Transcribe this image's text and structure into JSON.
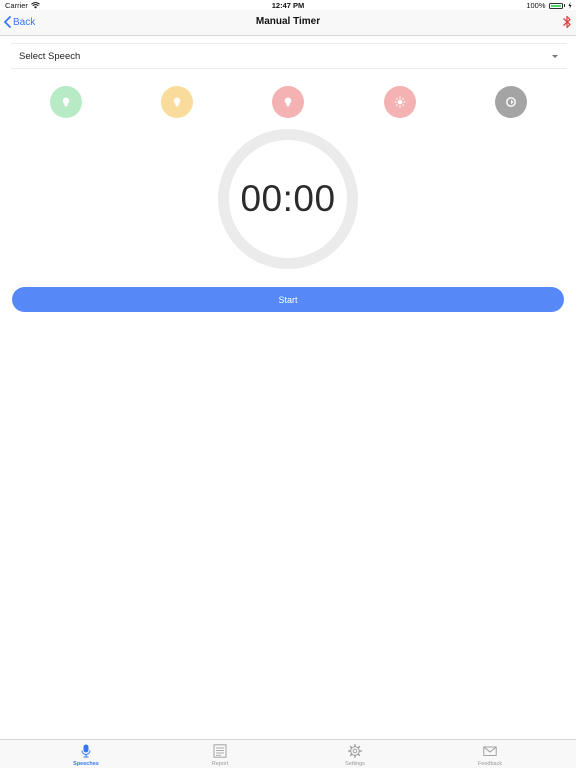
{
  "status_bar": {
    "carrier": "Carrier",
    "time": "12:47 PM",
    "battery": "100%",
    "battery_level": 1.0
  },
  "nav": {
    "back_label": "Back",
    "title": "Manual Timer"
  },
  "speech_select": {
    "label": "Select Speech"
  },
  "signals": [
    {
      "name": "green-light",
      "color": "#b7ebc6",
      "icon": "bulb-icon"
    },
    {
      "name": "yellow-light",
      "color": "#f9dc9c",
      "icon": "bulb-icon"
    },
    {
      "name": "red-light",
      "color": "#f4b2b2",
      "icon": "bulb-icon"
    },
    {
      "name": "overtime-light",
      "color": "#f4b2b2",
      "icon": "sun-icon"
    },
    {
      "name": "reset-light",
      "color": "#a4a4a4",
      "icon": "reset-icon"
    }
  ],
  "timer": {
    "display": "00:00"
  },
  "start_button": {
    "label": "Start"
  },
  "tabs": [
    {
      "label": "Speeches",
      "icon": "microphone-icon",
      "active": true
    },
    {
      "label": "Report",
      "icon": "report-icon",
      "active": false
    },
    {
      "label": "Settings",
      "icon": "gear-icon",
      "active": false
    },
    {
      "label": "Feedback",
      "icon": "mail-icon",
      "active": false
    }
  ],
  "colors": {
    "accent": "#3478f6",
    "start_button": "#5788f7",
    "bluetooth": "#e23a3a",
    "ring": "#ebebeb"
  }
}
